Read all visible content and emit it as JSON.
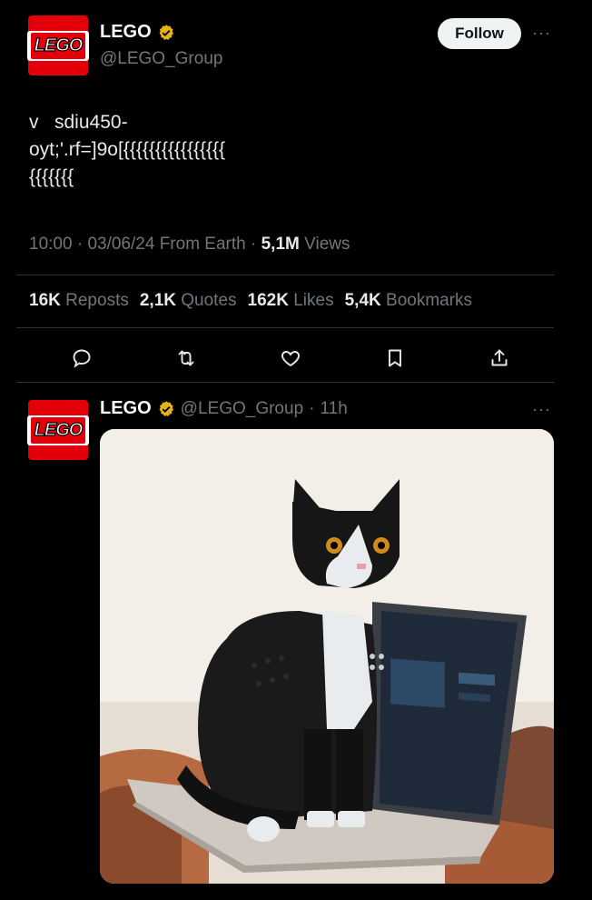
{
  "post": {
    "author_name": "LEGO",
    "handle": "@LEGO_Group",
    "follow_label": "Follow",
    "more": "···",
    "avatar_text": "LEGO",
    "body": "v   sdiu450-\noyt;'.rf=]9o[{{{{{{{{{{{{{{{{\n{{{{{{{",
    "time": "10:00",
    "date": "03/06/24",
    "source": "From Earth",
    "views_count": "5,1M",
    "views_label": "Views",
    "reposts_count": "16K",
    "reposts_label": "Reposts",
    "quotes_count": "2,1K",
    "quotes_label": "Quotes",
    "likes_count": "162K",
    "likes_label": "Likes",
    "bookmarks_count": "5,4K",
    "bookmarks_label": "Bookmarks",
    "actions": [
      "reply-icon",
      "repost-icon",
      "like-icon",
      "bookmark-icon",
      "share-icon"
    ]
  },
  "reply": {
    "author_name": "LEGO",
    "handle": "@LEGO_Group",
    "time_ago": "11h",
    "more": "···",
    "avatar_text": "LEGO",
    "media_subject": "LEGO tuxedo cat model sitting on a laptop"
  },
  "colors": {
    "background": "#000000",
    "text": "#e7e9ea",
    "muted": "#71767b",
    "divider": "#2f3336",
    "lego_red": "#e3000b",
    "verified_gold": "#e8b114"
  }
}
